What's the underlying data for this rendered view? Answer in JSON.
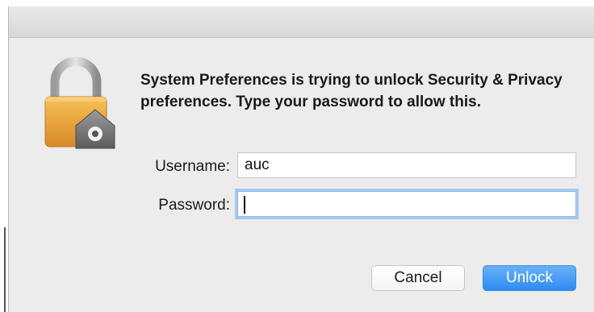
{
  "dialog": {
    "message": "System Preferences is trying to unlock Security & Privacy preferences. Type your password to allow this.",
    "icon": "lock-icon"
  },
  "username": {
    "label": "Username:",
    "value": "auc"
  },
  "password": {
    "label": "Password:",
    "value": ""
  },
  "buttons": {
    "cancel_label": "Cancel",
    "unlock_label": "Unlock"
  },
  "colors": {
    "accent": "#2e8bf2",
    "focus_ring": "#a7c8f0",
    "lock_body": "#e9a23b"
  }
}
